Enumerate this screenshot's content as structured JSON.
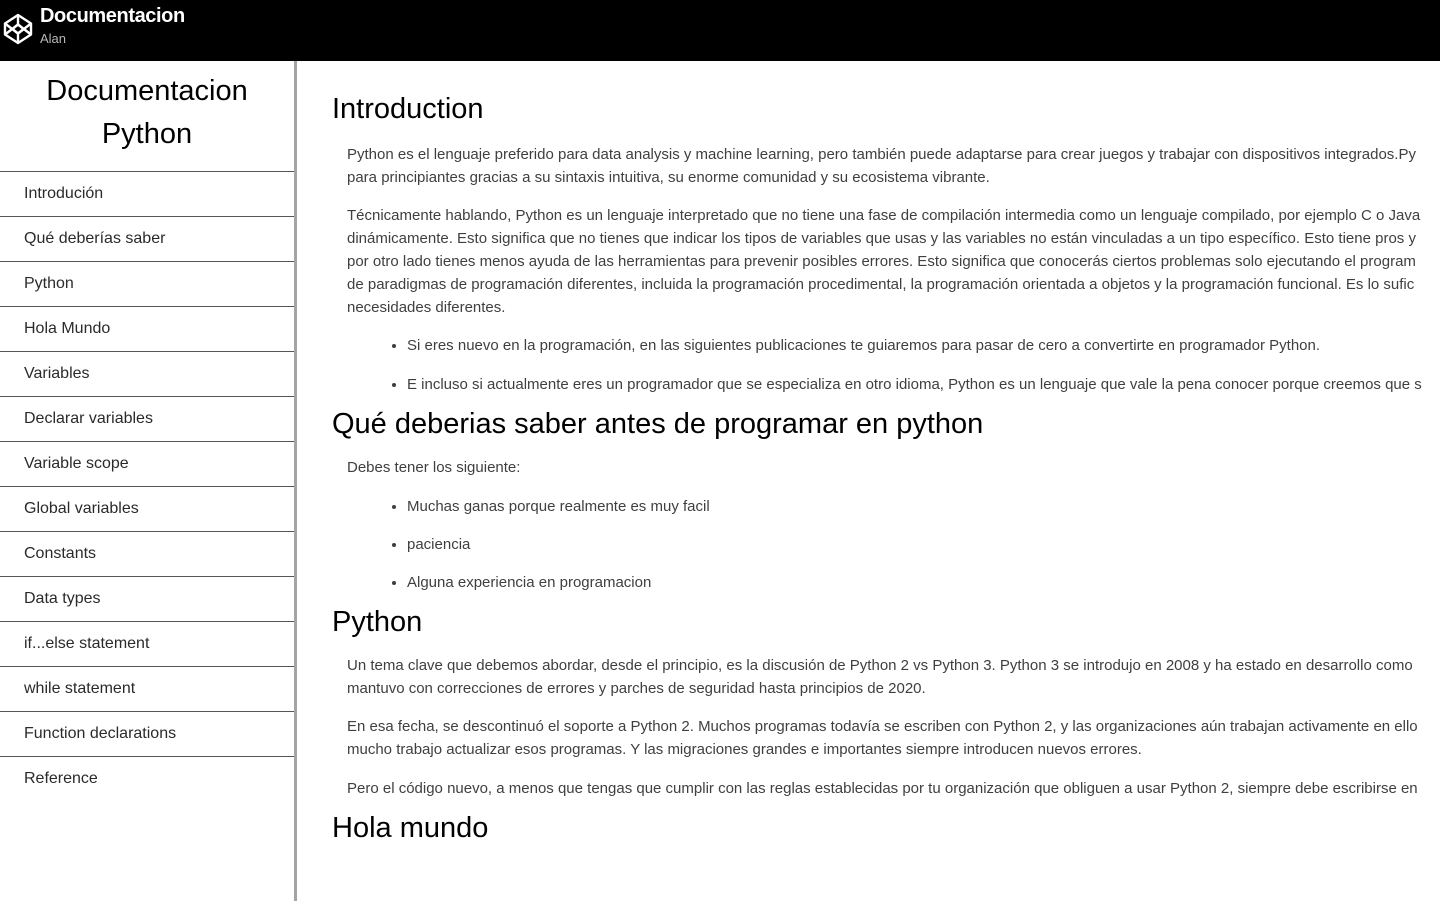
{
  "header": {
    "title": "Documentacion",
    "subtitle": "Alan",
    "logo_icon": "codepen-icon"
  },
  "sidebar": {
    "title_line1": "Documentacion",
    "title_line2": "Python",
    "items": [
      {
        "label": "Introdución"
      },
      {
        "label": "Qué deberías saber"
      },
      {
        "label": "Python"
      },
      {
        "label": "Hola Mundo"
      },
      {
        "label": "Variables"
      },
      {
        "label": "Declarar variables"
      },
      {
        "label": "Variable scope"
      },
      {
        "label": "Global variables"
      },
      {
        "label": "Constants"
      },
      {
        "label": "Data types"
      },
      {
        "label": "if...else statement"
      },
      {
        "label": "while statement"
      },
      {
        "label": "Function declarations"
      },
      {
        "label": "Reference"
      }
    ]
  },
  "main": {
    "sections": [
      {
        "heading": "Introduction",
        "p1_l1": "Python es el lenguaje preferido para data analysis y machine learning, pero también puede adaptarse para crear juegos y trabajar con dispositivos integrados.Py",
        "p1_l2": "para principiantes gracias a su sintaxis intuitiva, su enorme comunidad y su ecosistema vibrante.",
        "p2_l1": "Técnicamente hablando, Python es un lenguaje interpretado que no tiene una fase de compilación intermedia como un lenguaje compilado, por ejemplo C o Java",
        "p2_l2": "dinámicamente. Esto significa que no tienes que indicar los tipos de variables que usas y las variables no están vinculadas a un tipo específico. Esto tiene pros y",
        "p2_l3": "por otro lado tienes menos ayuda de las herramientas para prevenir posibles errores. Esto significa que conocerás ciertos problemas solo ejecutando el program",
        "p2_l4": "de paradigmas de programación diferentes, incluida la programación procedimental, la programación orientada a objetos y la programación funcional. Es lo sufic",
        "p2_l5": "necesidades diferentes.",
        "bullets": [
          "Si eres nuevo en la programación, en las siguientes publicaciones te guiaremos para pasar de cero a convertirte en programador Python.",
          "E incluso si actualmente eres un programador que se especializa en otro idioma, Python es un lenguaje que vale la pena conocer porque creemos que s"
        ]
      },
      {
        "heading": "Qué deberias saber antes de programar en python",
        "p1": "Debes tener los siguiente:",
        "bullets": [
          "Muchas ganas porque realmente es muy facil",
          "paciencia",
          "Alguna experiencia en programacion"
        ]
      },
      {
        "heading": "Python",
        "p1_l1": "Un tema clave que debemos abordar, desde el principio, es la discusión de Python 2 vs Python 3. Python 3 se introdujo en 2008 y ha estado en desarrollo como",
        "p1_l2": "mantuvo con correcciones de errores y parches de seguridad hasta principios de 2020.",
        "p2_l1": "En esa fecha, se descontinuó el soporte a Python 2. Muchos programas todavía se escriben con Python 2, y las organizaciones aún trabajan activamente en ello",
        "p2_l2": "mucho trabajo actualizar esos programas. Y las migraciones grandes e importantes siempre introducen nuevos errores.",
        "p3": "Pero el código nuevo, a menos que tengas que cumplir con las reglas establecidas por tu organización que obliguen a usar Python 2, siempre debe escribirse en"
      },
      {
        "heading": "Hola mundo"
      }
    ]
  }
}
